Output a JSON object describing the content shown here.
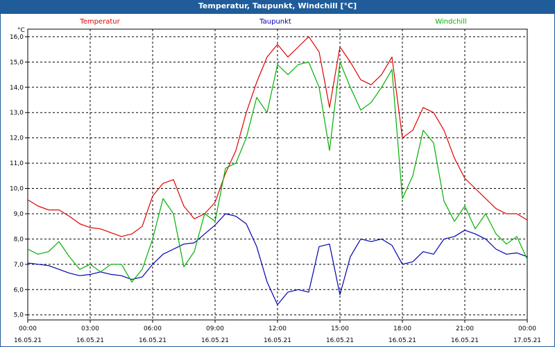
{
  "window": {
    "title": "Temperatur, Taupunkt, Windchill [°C]"
  },
  "chart_data": {
    "type": "line",
    "title": "Temperatur, Taupunkt, Windchill [°C]",
    "ylabel": "°C",
    "ylim": [
      4.8,
      16.3
    ],
    "xlim": [
      0,
      24
    ],
    "grid": true,
    "yticks": [
      "16,0",
      "15,0",
      "14,0",
      "13,0",
      "12,0",
      "11,0",
      "10,0",
      "9,0",
      "8,0",
      "7,0",
      "6,0",
      "5,0"
    ],
    "ytick_values": [
      16,
      15,
      14,
      13,
      12,
      11,
      10,
      9,
      8,
      7,
      6,
      5
    ],
    "xticks": [
      {
        "time": "00:00",
        "date": "16.05.21",
        "h": 0
      },
      {
        "time": "03:00",
        "date": "16.05.21",
        "h": 3
      },
      {
        "time": "06:00",
        "date": "16.05.21",
        "h": 6
      },
      {
        "time": "09:00",
        "date": "16.05.21",
        "h": 9
      },
      {
        "time": "12:00",
        "date": "16.05.21",
        "h": 12
      },
      {
        "time": "15:00",
        "date": "16.05.21",
        "h": 15
      },
      {
        "time": "18:00",
        "date": "16.05.21",
        "h": 18
      },
      {
        "time": "21:00",
        "date": "16.05.21",
        "h": 21
      },
      {
        "time": "00:00",
        "date": "17.05.21",
        "h": 24
      }
    ],
    "series": [
      {
        "name": "Temperatur",
        "color": "#e00000",
        "legend_pos": "left",
        "points": [
          [
            0,
            9.55
          ],
          [
            0.5,
            9.3
          ],
          [
            1,
            9.15
          ],
          [
            1.5,
            9.15
          ],
          [
            2,
            8.9
          ],
          [
            2.5,
            8.6
          ],
          [
            3,
            8.45
          ],
          [
            3.5,
            8.4
          ],
          [
            4,
            8.25
          ],
          [
            4.5,
            8.1
          ],
          [
            5,
            8.2
          ],
          [
            5.5,
            8.5
          ],
          [
            6,
            9.7
          ],
          [
            6.5,
            10.2
          ],
          [
            7,
            10.35
          ],
          [
            7.5,
            9.3
          ],
          [
            8,
            8.8
          ],
          [
            8.5,
            9.0
          ],
          [
            9,
            9.45
          ],
          [
            9.5,
            10.6
          ],
          [
            10,
            11.5
          ],
          [
            10.5,
            13.0
          ],
          [
            11,
            14.2
          ],
          [
            11.5,
            15.2
          ],
          [
            12,
            15.7
          ],
          [
            12.5,
            15.2
          ],
          [
            13,
            15.6
          ],
          [
            13.5,
            16.0
          ],
          [
            14,
            15.4
          ],
          [
            14.5,
            13.2
          ],
          [
            15,
            15.6
          ],
          [
            15.5,
            15.0
          ],
          [
            16,
            14.3
          ],
          [
            16.5,
            14.1
          ],
          [
            17,
            14.5
          ],
          [
            17.5,
            15.2
          ],
          [
            18,
            12.0
          ],
          [
            18.5,
            12.3
          ],
          [
            19,
            13.2
          ],
          [
            19.5,
            13.0
          ],
          [
            20,
            12.3
          ],
          [
            20.5,
            11.2
          ],
          [
            21,
            10.4
          ],
          [
            21.5,
            10.0
          ],
          [
            22,
            9.6
          ],
          [
            22.5,
            9.2
          ],
          [
            23,
            9.0
          ],
          [
            23.5,
            9.0
          ],
          [
            24,
            8.75
          ]
        ]
      },
      {
        "name": "Taupunkt",
        "color": "#0000b0",
        "legend_pos": "center",
        "points": [
          [
            0,
            7.05
          ],
          [
            0.5,
            7.0
          ],
          [
            1,
            6.95
          ],
          [
            1.5,
            6.8
          ],
          [
            2,
            6.65
          ],
          [
            2.5,
            6.55
          ],
          [
            3,
            6.6
          ],
          [
            3.5,
            6.7
          ],
          [
            4,
            6.6
          ],
          [
            4.5,
            6.55
          ],
          [
            5,
            6.4
          ],
          [
            5.5,
            6.5
          ],
          [
            6,
            7.0
          ],
          [
            6.5,
            7.4
          ],
          [
            7,
            7.6
          ],
          [
            7.5,
            7.8
          ],
          [
            8,
            7.85
          ],
          [
            8.5,
            8.2
          ],
          [
            9,
            8.55
          ],
          [
            9.5,
            9.0
          ],
          [
            10,
            8.9
          ],
          [
            10.5,
            8.6
          ],
          [
            11,
            7.7
          ],
          [
            11.5,
            6.3
          ],
          [
            12,
            5.4
          ],
          [
            12.5,
            5.9
          ],
          [
            13,
            6.0
          ],
          [
            13.5,
            5.9
          ],
          [
            14,
            7.7
          ],
          [
            14.5,
            7.8
          ],
          [
            15,
            5.8
          ],
          [
            15.5,
            7.3
          ],
          [
            16,
            8.0
          ],
          [
            16.5,
            7.9
          ],
          [
            17,
            8.0
          ],
          [
            17.5,
            7.75
          ],
          [
            18,
            7.0
          ],
          [
            18.5,
            7.1
          ],
          [
            19,
            7.5
          ],
          [
            19.5,
            7.4
          ],
          [
            20,
            8.0
          ],
          [
            20.5,
            8.1
          ],
          [
            21,
            8.35
          ],
          [
            21.5,
            8.2
          ],
          [
            22,
            8.0
          ],
          [
            22.5,
            7.6
          ],
          [
            23,
            7.4
          ],
          [
            23.5,
            7.45
          ],
          [
            24,
            7.3
          ]
        ]
      },
      {
        "name": "Windchill",
        "color": "#00b000",
        "legend_pos": "right",
        "points": [
          [
            0,
            7.6
          ],
          [
            0.5,
            7.4
          ],
          [
            1,
            7.5
          ],
          [
            1.5,
            7.9
          ],
          [
            2,
            7.3
          ],
          [
            2.5,
            6.8
          ],
          [
            3,
            7.0
          ],
          [
            3.5,
            6.7
          ],
          [
            4,
            7.0
          ],
          [
            4.5,
            7.0
          ],
          [
            5,
            6.3
          ],
          [
            5.5,
            6.8
          ],
          [
            6,
            8.0
          ],
          [
            6.5,
            9.6
          ],
          [
            7,
            9.0
          ],
          [
            7.5,
            6.9
          ],
          [
            8,
            7.5
          ],
          [
            8.5,
            9.0
          ],
          [
            9,
            8.7
          ],
          [
            9.5,
            10.8
          ],
          [
            10,
            11.0
          ],
          [
            10.5,
            12.0
          ],
          [
            11,
            13.6
          ],
          [
            11.5,
            13.0
          ],
          [
            12,
            14.9
          ],
          [
            12.5,
            14.5
          ],
          [
            13,
            14.9
          ],
          [
            13.5,
            15.0
          ],
          [
            14,
            14.0
          ],
          [
            14.5,
            11.5
          ],
          [
            15,
            15.0
          ],
          [
            15.5,
            14.0
          ],
          [
            16,
            13.1
          ],
          [
            16.5,
            13.4
          ],
          [
            17,
            14.0
          ],
          [
            17.5,
            14.7
          ],
          [
            18,
            9.6
          ],
          [
            18.5,
            10.5
          ],
          [
            19,
            12.3
          ],
          [
            19.5,
            11.8
          ],
          [
            20,
            9.5
          ],
          [
            20.5,
            8.7
          ],
          [
            21,
            9.3
          ],
          [
            21.5,
            8.4
          ],
          [
            22,
            9.0
          ],
          [
            22.5,
            8.2
          ],
          [
            23,
            7.8
          ],
          [
            23.5,
            8.1
          ],
          [
            24,
            7.2
          ]
        ]
      }
    ]
  }
}
